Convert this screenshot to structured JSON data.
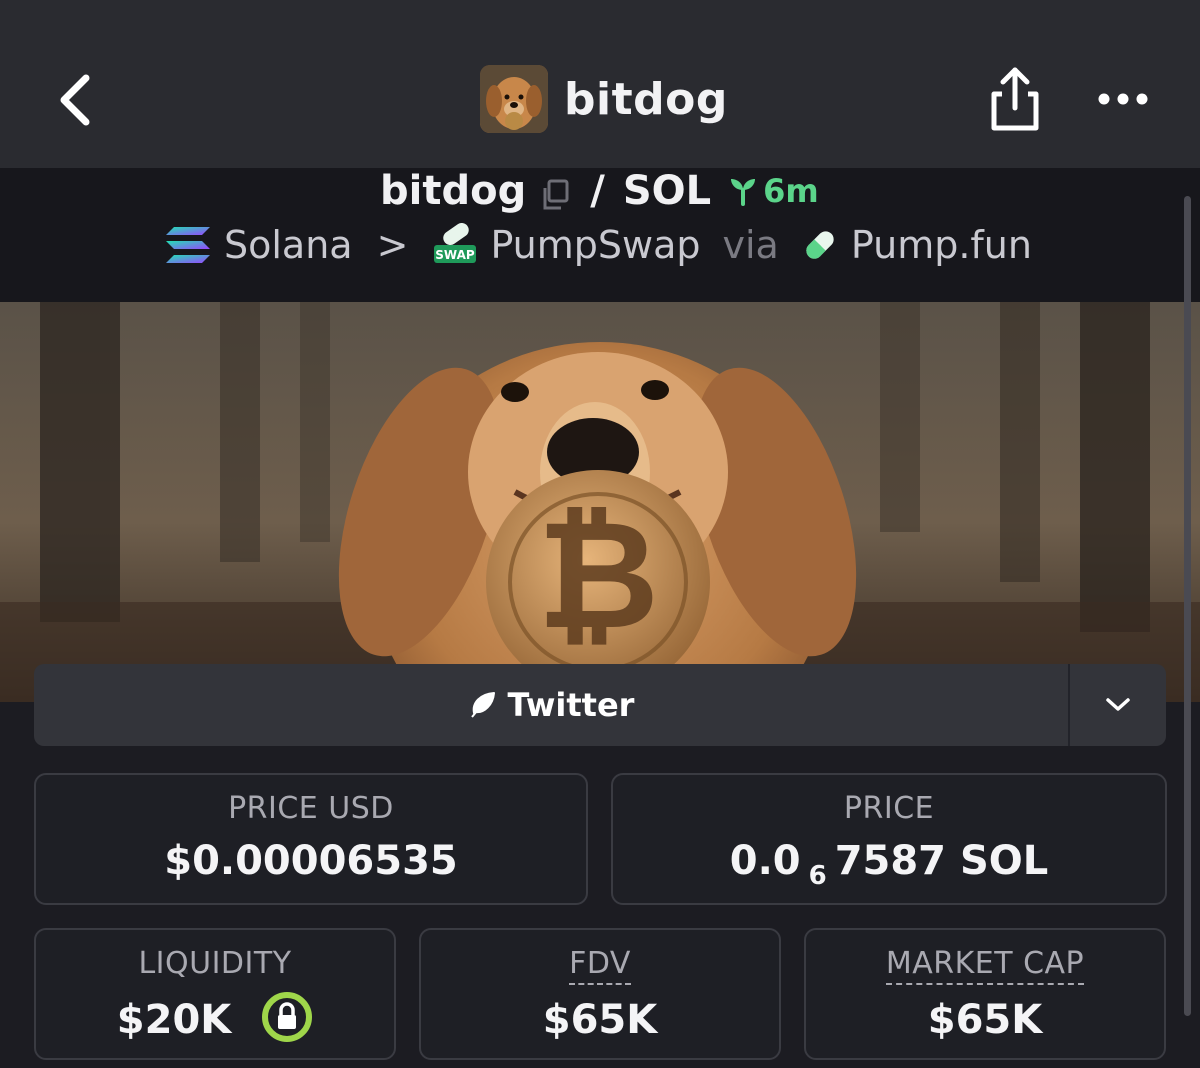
{
  "nav": {
    "title": "bitdog",
    "back_icon": "chevron-left-icon",
    "share_icon": "share-icon",
    "more_icon": "more-horizontal-icon"
  },
  "pair": {
    "base": "bitdog",
    "slash": "/",
    "quote": "SOL",
    "age": "6m"
  },
  "breadcrumb": {
    "chain": "Solana",
    "separator": ">",
    "dex": "PumpSwap",
    "via": "via",
    "launchpad": "Pump.fun",
    "swap_badge": "SWAP"
  },
  "social": {
    "twitter_label": "Twitter"
  },
  "stats": {
    "price_usd_label": "PRICE USD",
    "price_usd_value": "$0.00006535",
    "price_label": "PRICE",
    "price_value_prefix": "0.0",
    "price_value_subscript": "6",
    "price_value_suffix": "7587 SOL",
    "liquidity_label": "LIQUIDITY",
    "liquidity_value": "$20K",
    "fdv_label": "FDV",
    "fdv_value": "$65K",
    "mcap_label": "MARKET CAP",
    "mcap_value": "$65K"
  },
  "colors": {
    "accent_green": "#5bd48a",
    "lock_green": "#9fd64a",
    "background": "#1c1c22"
  }
}
